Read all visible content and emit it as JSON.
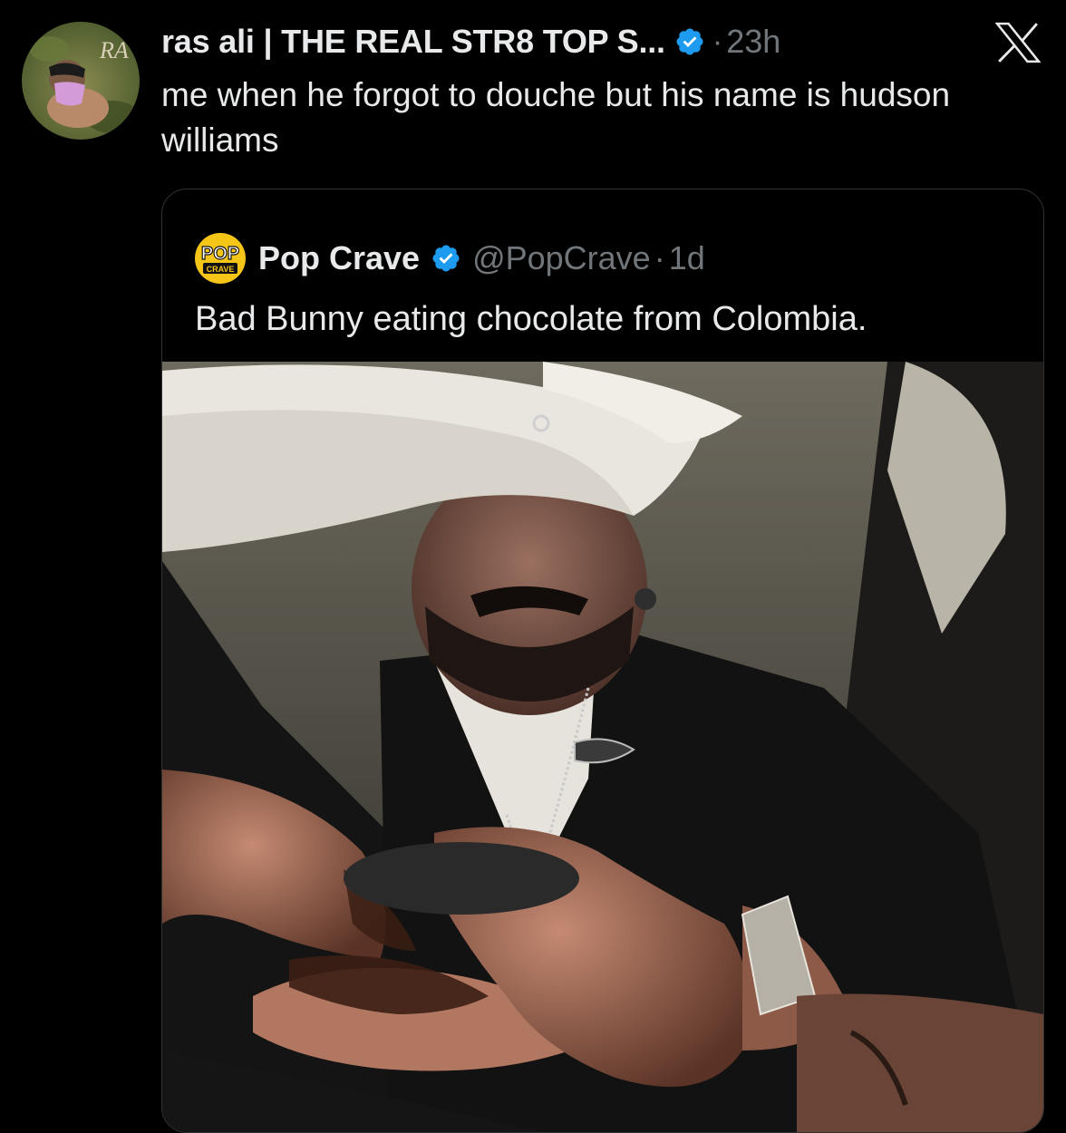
{
  "author": {
    "display_name": "ras ali | THE REAL STR8 TOP S...",
    "time": "23h",
    "separator": "·",
    "avatar_initials": "RA"
  },
  "tweet": {
    "text": "me when he forgot to douche but his name is hudson williams"
  },
  "quoted": {
    "display_name": "Pop Crave",
    "handle": "@PopCrave",
    "separator": "·",
    "time": "1d",
    "text": "Bad Bunny eating chocolate from Colombia.",
    "logo_top": "POP",
    "logo_bottom": "CRAVE",
    "media_kind": "video-frame"
  },
  "icons": {
    "verified": "verified-badge-icon",
    "platform": "x-logo-icon"
  },
  "colors": {
    "background": "#000000",
    "text": "#e7e9ea",
    "secondary": "#71767b",
    "verified": "#1d9bf0",
    "border": "#2f3336",
    "pop_crave_yellow": "#f5c518"
  }
}
